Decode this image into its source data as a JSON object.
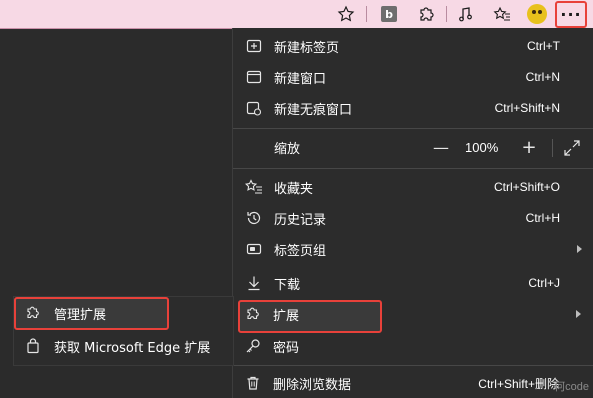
{
  "toolbar": {
    "extension_badge_letter": "b",
    "more_button_label": "···",
    "icons": [
      "star-icon",
      "extension-b-icon",
      "puzzle-icon",
      "music-icon",
      "favorites-icon",
      "profile-avatar",
      "more-icon"
    ]
  },
  "menu": {
    "items": [
      {
        "label": "新建标签页",
        "shortcut": "Ctrl+T",
        "icon": "new-tab-icon"
      },
      {
        "label": "新建窗口",
        "shortcut": "Ctrl+N",
        "icon": "new-window-icon"
      },
      {
        "label": "新建无痕窗口",
        "shortcut": "Ctrl+Shift+N",
        "icon": "inprivate-icon"
      },
      {
        "label": "缩放",
        "icon": ""
      },
      {
        "label": "收藏夹",
        "shortcut": "Ctrl+Shift+O",
        "icon": "favorites-icon"
      },
      {
        "label": "历史记录",
        "shortcut": "Ctrl+H",
        "icon": "history-icon"
      },
      {
        "label": "标签页组",
        "icon": "tab-groups-icon",
        "has_submenu": true
      },
      {
        "label": "下载",
        "shortcut": "Ctrl+J",
        "icon": "download-icon"
      },
      {
        "label": "扩展",
        "icon": "extensions-icon",
        "has_submenu": true
      },
      {
        "label": "密码",
        "icon": "key-icon"
      },
      {
        "label": "删除浏览数据",
        "shortcut": "Ctrl+Shift+删除",
        "icon": "trash-icon"
      }
    ],
    "zoom": {
      "minus": "—",
      "value": "100%",
      "plus": "+"
    }
  },
  "submenu": {
    "items": [
      {
        "label": "管理扩展",
        "icon": "puzzle-icon"
      },
      {
        "label": "获取 Microsoft Edge 扩展",
        "icon": "store-bag-icon"
      }
    ]
  },
  "watermark": "何code",
  "colors": {
    "toolbar_bg": "#f7d9e5",
    "menu_bg": "#2c2c2c",
    "page_bg": "#2b2b2b",
    "highlight_border": "#e8413a"
  }
}
